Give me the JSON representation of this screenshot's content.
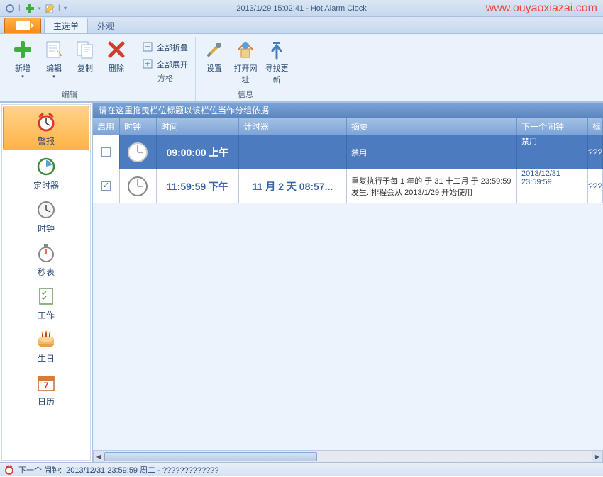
{
  "title": "2013/1/29 15:02:41 - Hot Alarm Clock",
  "watermark": "www.ouyaoxiazai.com",
  "tabs": {
    "main": "主选单",
    "appearance": "外观"
  },
  "ribbon": {
    "group_edit": "编辑",
    "group_grid": "方格",
    "group_info": "信息",
    "new": "新增",
    "edit": "编辑",
    "copy": "复制",
    "delete": "删除",
    "collapse_all": "全部折叠",
    "expand_all": "全部展开",
    "settings": "设置",
    "open_url": "打开网址",
    "check_update": "寻找更新"
  },
  "sidebar": {
    "alarm": "警报",
    "timer": "定时器",
    "clock": "时钟",
    "stopwatch": "秒表",
    "task": "工作",
    "birthday": "生日",
    "calendar": "日历"
  },
  "grid": {
    "group_hint": "请在这里拖曳栏位标题以该栏位当作分组依据",
    "col_enable": "启用",
    "col_clock": "时钟",
    "col_time": "时间",
    "col_timer": "计时器",
    "col_summary": "摘要",
    "col_next": "下一个闹钟",
    "col_mark": "标",
    "rows": [
      {
        "enabled": false,
        "time": "09:00:00 上午",
        "timer": "",
        "summary": "禁用",
        "next": "禁用",
        "mark": "???"
      },
      {
        "enabled": true,
        "time": "11:59:59 下午",
        "timer": "11 月 2 天 08:57...",
        "summary": "重复执行于每 1 年的 于 31 十二月 于 23:59:59 发生. 排程会从 2013/1/29 开始使用",
        "next_line1": "2013/12/31",
        "next_line2": "23:59:59",
        "mark": "???"
      }
    ]
  },
  "status": {
    "label": "下一个 闹钟:",
    "value": "2013/12/31 23:59:59 周二 - ?????????????"
  }
}
